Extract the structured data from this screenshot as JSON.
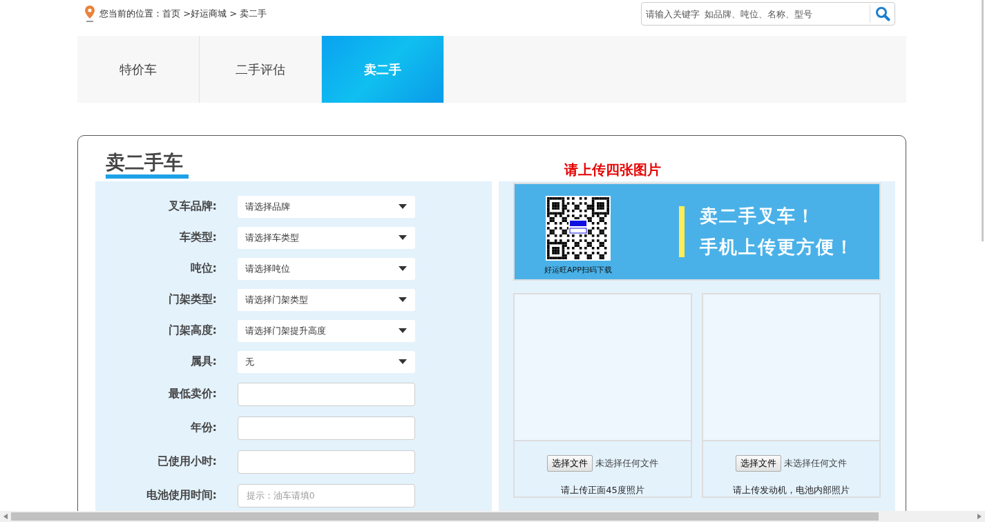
{
  "breadcrumb": {
    "text": "您当前的位置：首页 >好运商城 > 卖二手"
  },
  "search": {
    "placeholder": "请输入关键字  如品牌、吨位、名称、型号"
  },
  "tabs": [
    {
      "label": "特价车",
      "selected": false
    },
    {
      "label": "二手评估",
      "selected": false
    },
    {
      "label": "卖二手",
      "selected": true
    }
  ],
  "title": "卖二手车",
  "upload_notice": "请上传四张图片",
  "form": [
    {
      "kind": "select",
      "label": "叉车品牌:",
      "value": "请选择品牌"
    },
    {
      "kind": "select",
      "label": "车类型:",
      "value": "请选择车类型"
    },
    {
      "kind": "select",
      "label": "吨位:",
      "value": "请选择吨位"
    },
    {
      "kind": "select",
      "label": "门架类型:",
      "value": "请选择门架类型"
    },
    {
      "kind": "select",
      "label": "门架高度:",
      "value": "请选择门架提升高度"
    },
    {
      "kind": "select",
      "label": "属具:",
      "value": "无"
    },
    {
      "kind": "input",
      "label": "最低卖价:"
    },
    {
      "kind": "input",
      "label": "年份:"
    },
    {
      "kind": "input",
      "label": "已使用小时:"
    },
    {
      "kind": "input",
      "label": "电池使用时间:",
      "placeholder": "提示：油车请填0"
    }
  ],
  "banner": {
    "qr_caption": "好运旺APP扫码下载",
    "headline": [
      "卖二手叉车！",
      "手机上传更方便！"
    ]
  },
  "uploads": [
    {
      "button": "选择文件",
      "status": "未选择任何文件",
      "caption": "请上传正面45度照片"
    },
    {
      "button": "选择文件",
      "status": "未选择任何文件",
      "caption": "请上传发动机，电池内部照片"
    }
  ]
}
